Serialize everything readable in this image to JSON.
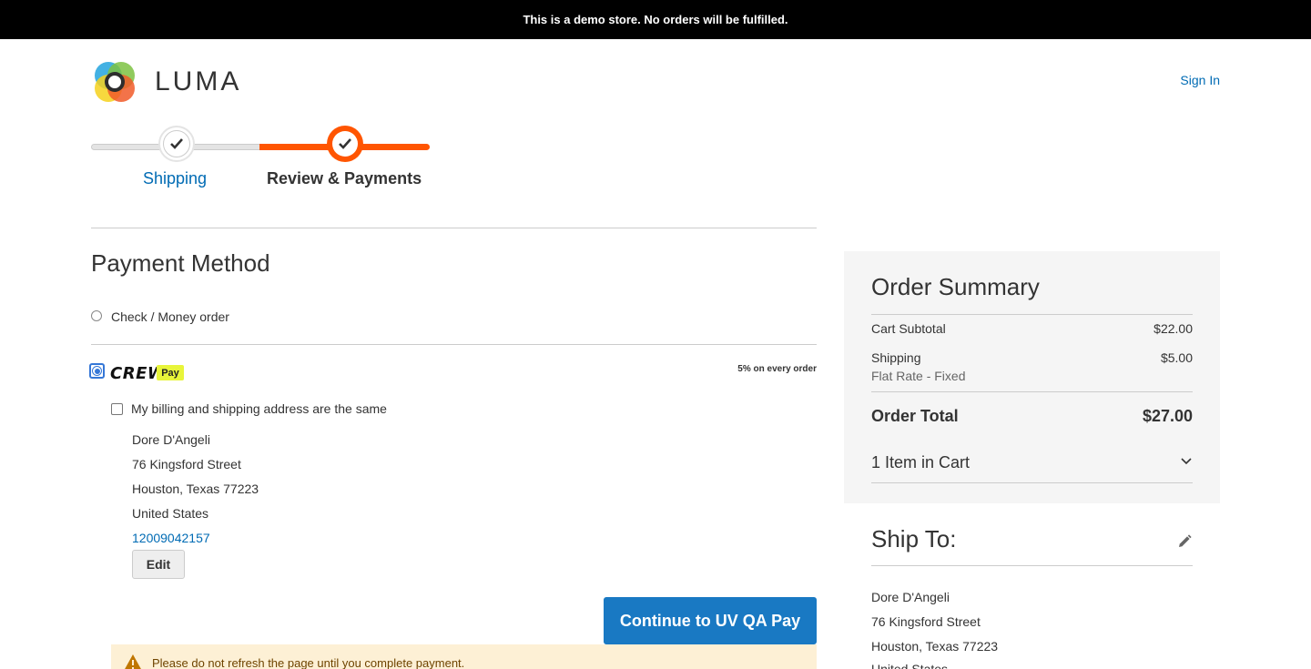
{
  "banner": {
    "text": "This is a demo store. No orders will be fulfilled."
  },
  "header": {
    "logo_text": "LUMA",
    "sign_in": "Sign In"
  },
  "progress": {
    "steps": [
      {
        "label": "Shipping",
        "complete": true
      },
      {
        "label": "Review & Payments",
        "active": true
      }
    ]
  },
  "payment": {
    "title": "Payment Method",
    "options": [
      {
        "label": "Check / Money order",
        "selected": false
      },
      {
        "logo_text": "CREW",
        "badge": "Pay",
        "promo": "5% on every order",
        "selected": true
      }
    ],
    "same_address_label": "My billing and shipping address are the same",
    "billing": {
      "name": "Dore D'Angeli",
      "street": "76 Kingsford Street",
      "city_line": "Houston, Texas 77223",
      "country": "United States",
      "phone": "12009042157"
    },
    "edit_label": "Edit",
    "continue_label": "Continue to UV QA Pay",
    "warning_text": "Please do not refresh the page until you complete payment."
  },
  "summary": {
    "title": "Order Summary",
    "subtotal_label": "Cart Subtotal",
    "subtotal": "$22.00",
    "shipping_label": "Shipping",
    "shipping": "$5.00",
    "shipping_method": "Flat Rate - Fixed",
    "total_label": "Order Total",
    "total": "$27.00",
    "items_label": "1 Item in Cart"
  },
  "ship_to": {
    "title": "Ship To:",
    "name": "Dore D'Angeli",
    "street": "76 Kingsford Street",
    "city_line": "Houston, Texas 77223",
    "country": "United States"
  },
  "colors": {
    "accent": "#ff5501",
    "link": "#006bb4",
    "button": "#1979c3",
    "warning_bg": "#fdf0d5"
  }
}
